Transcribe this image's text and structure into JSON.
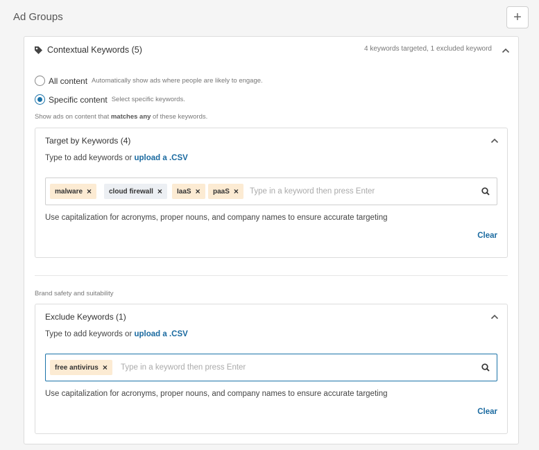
{
  "header": {
    "title": "Ad Groups",
    "add_label": "+"
  },
  "panel": {
    "title": "Contextual Keywords (5)",
    "summary": "4 keywords targeted, 1 excluded keyword",
    "options": [
      {
        "label": "All content",
        "help": "Automatically show ads where people are likely to engage.",
        "selected": false
      },
      {
        "label": "Specific content",
        "help": "Select specific keywords.",
        "selected": true
      }
    ],
    "hint_prefix": "Show ads on content that ",
    "hint_bold": "matches any",
    "hint_suffix": " of these keywords."
  },
  "target": {
    "title": "Target by Keywords (4)",
    "sub_prefix": "Type to add keywords or ",
    "sub_link": "upload a .CSV",
    "keywords": [
      "malware",
      "cloud firewall",
      "IaaS",
      "paaS"
    ],
    "placeholder": "Type in a keyword then press Enter",
    "note": "Use capitalization for acronyms, proper nouns, and company names to ensure accurate targeting",
    "clear_label": "Clear"
  },
  "section_label": "Brand safety and suitability",
  "exclude": {
    "title": "Exclude Keywords (1)",
    "sub_prefix": "Type to add keywords or ",
    "sub_link": "upload a .CSV",
    "keywords": [
      "free antivirus"
    ],
    "placeholder": "Type in a keyword then press Enter",
    "note": "Use capitalization for acronyms, proper nouns, and company names to ensure accurate targeting",
    "clear_label": "Clear"
  },
  "colors": {
    "accent": "#1a72a8",
    "link": "#1a6aa0",
    "chip": "#fcebd3",
    "chip_alt": "#eceff3"
  },
  "icons": {
    "tag": "tag-icon",
    "chevron": "chevron-up-icon",
    "search": "search-icon",
    "remove": "close-icon"
  }
}
